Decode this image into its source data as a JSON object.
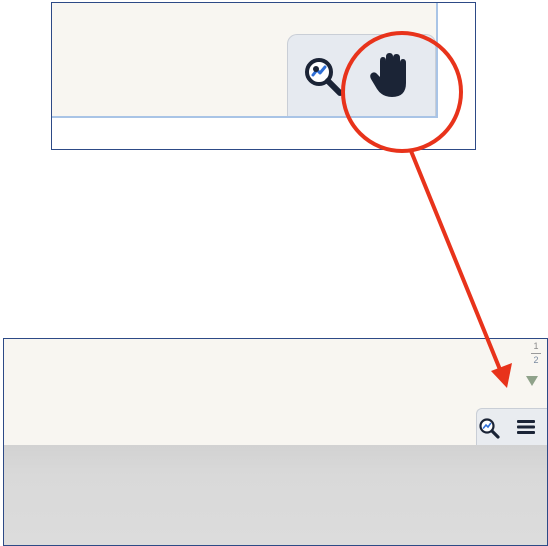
{
  "page_indicator": {
    "separator_top": "1",
    "current": "2"
  },
  "icons": {
    "top_zoom": "zoom-icon",
    "top_hand": "hand-icon",
    "bottom_zoom": "zoom-icon",
    "bottom_menu": "menu-icon",
    "page_down": "triangle-down-icon"
  },
  "colors": {
    "canvas": "#f8f6f1",
    "tab": "#e6eaf0",
    "annotation": "#e8331b",
    "border": "#2d4a86",
    "icon": "#1b2436",
    "page_arrow": "#8fa28a"
  }
}
